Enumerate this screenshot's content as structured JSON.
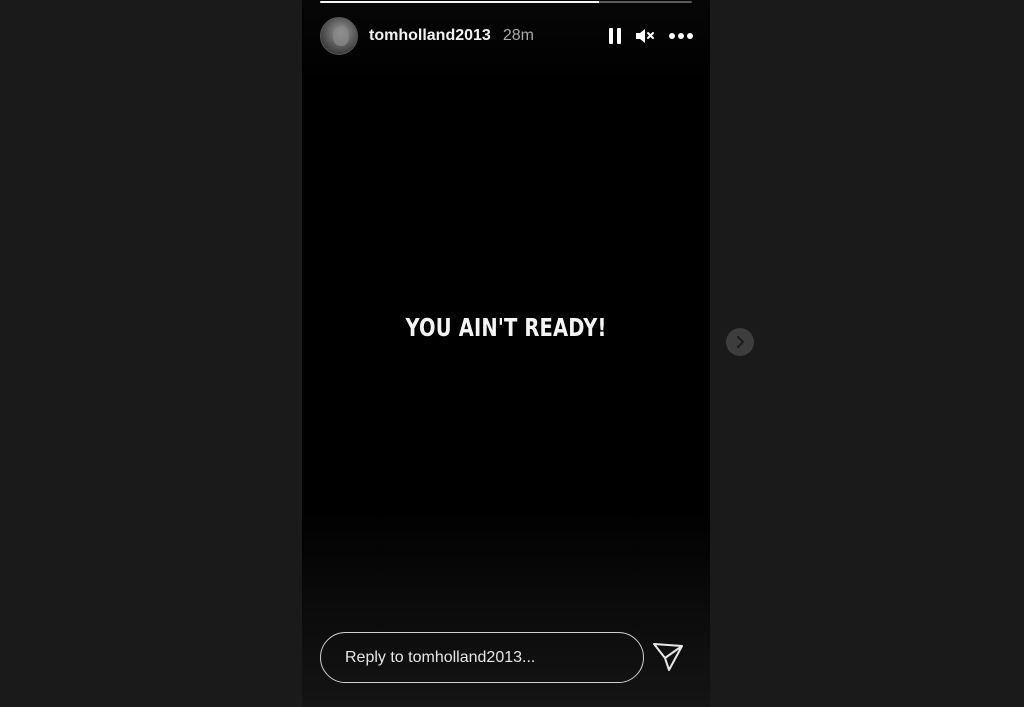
{
  "story": {
    "progress": 0.75,
    "user": {
      "username": "tomholland2013",
      "timestamp": "28m"
    },
    "text": "YOU AIN'T READY!",
    "reply_placeholder": "Reply to tomholland2013..."
  },
  "icons": {
    "avatar": "profile-avatar",
    "pause": "pause-icon",
    "mute": "speaker-muted-icon",
    "more": "more-dots-icon",
    "send": "send-paper-plane-icon",
    "next": "chevron-right-icon"
  },
  "colors": {
    "background": "#1a1a1a",
    "story_background": "#000000",
    "text": "#f4f4f4",
    "muted_text": "#a8a8a8"
  }
}
